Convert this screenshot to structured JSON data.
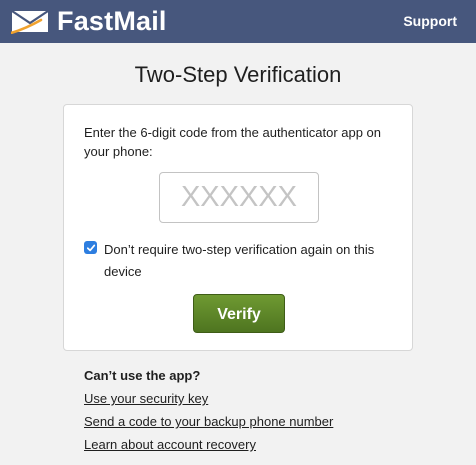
{
  "header": {
    "brand": "FastMail",
    "logo_icon": "envelope-icon",
    "support_label": "Support",
    "background": "#47577d"
  },
  "page": {
    "title": "Two-Step Verification"
  },
  "form": {
    "instruction": "Enter the 6-digit code from the authenticator app on your phone:",
    "code_placeholder": "XXXXXX",
    "code_value": "",
    "remember_checked": true,
    "remember_label": "Don’t require two-step verification again on this device",
    "verify_label": "Verify",
    "verify_color": "#5f8a2a"
  },
  "help": {
    "heading": "Can’t use the app?",
    "links": [
      {
        "label": "Use your security key"
      },
      {
        "label": "Send a code to your backup phone number"
      },
      {
        "label": "Learn about account recovery"
      }
    ]
  }
}
